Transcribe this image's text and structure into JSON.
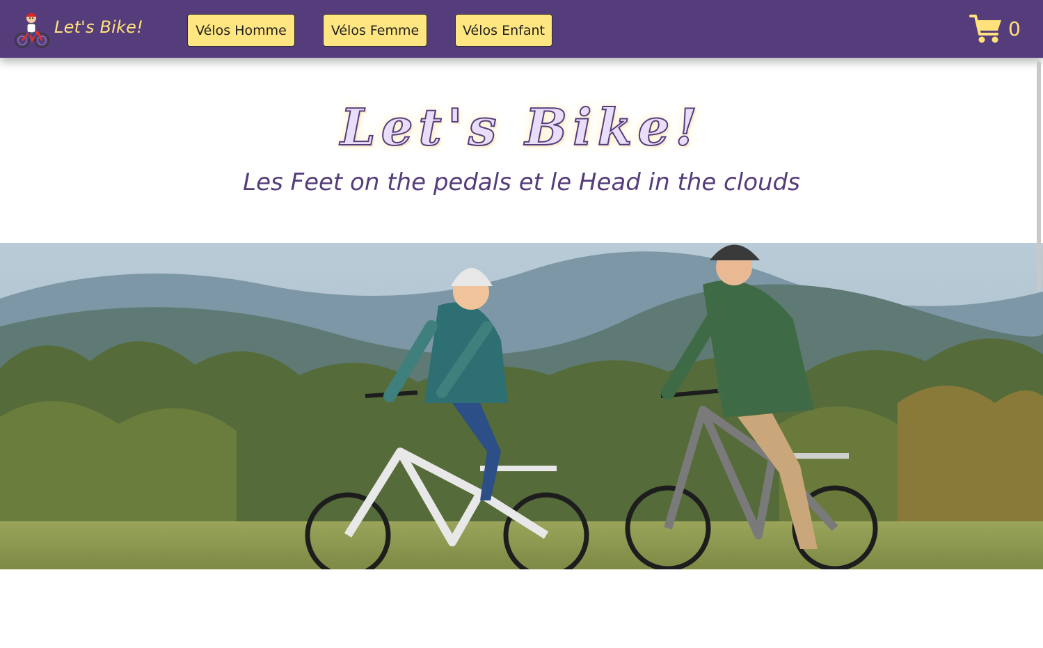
{
  "navbar": {
    "brand_text": "Let's Bike!",
    "brand_logo_icon": "cyclist-kid-logo-icon",
    "buttons": [
      {
        "label": "Vélos Homme"
      },
      {
        "label": "Vélos Femme"
      },
      {
        "label": "Vélos Enfant"
      }
    ],
    "cart": {
      "icon": "shopping-cart-icon",
      "count": "0"
    }
  },
  "hero": {
    "title": "Let's Bike!",
    "tagline": "Les Feet on the pedals et le Head in the clouds"
  },
  "banner": {
    "image": "two-cyclists-on-e-bikes-photo"
  },
  "colors": {
    "navbar_bg": "#553c7b",
    "accent_yellow": "#ffe680",
    "brand_text": "#ffe27a",
    "title_purple": "#553c7b"
  }
}
